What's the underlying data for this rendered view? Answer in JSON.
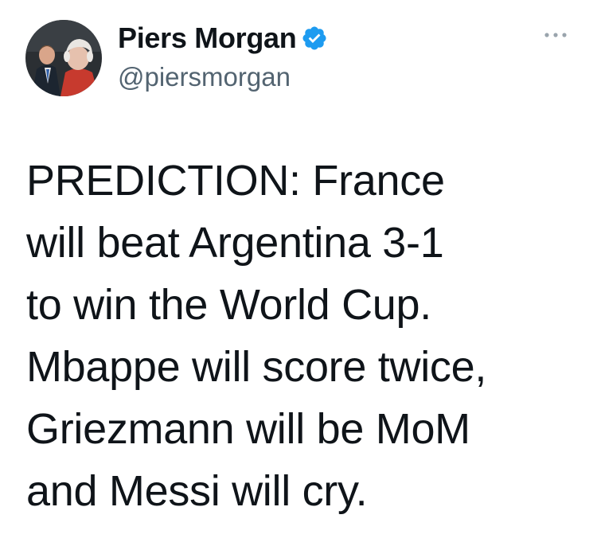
{
  "author": {
    "display_name": "Piers Morgan",
    "handle": "@piersmorgan",
    "verified": true,
    "verified_color": "#1d9bf0"
  },
  "tweet": {
    "lines": [
      "PREDICTION: France",
      "will beat Argentina 3-1",
      "to win the World Cup.",
      "Mbappe will score twice,",
      "Griezmann will be MoM",
      "and Messi will cry."
    ]
  },
  "icons": {
    "more": "more-options-icon",
    "verified": "verified-badge-icon"
  },
  "colors": {
    "text": "#0f1419",
    "secondary": "#536471",
    "background": "#ffffff"
  }
}
